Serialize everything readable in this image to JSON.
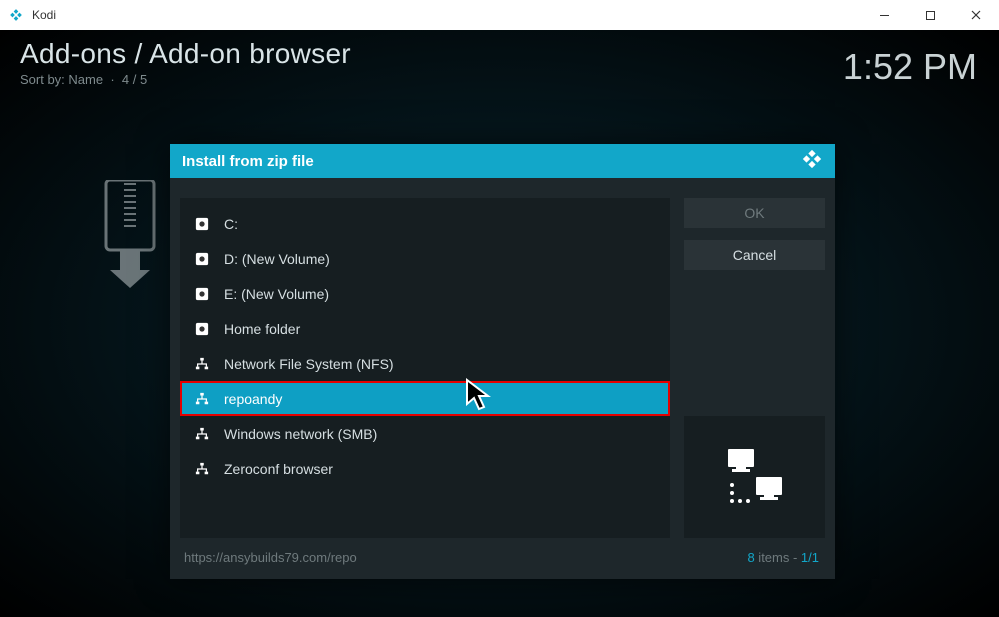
{
  "titlebar": {
    "app_name": "Kodi"
  },
  "header": {
    "breadcrumb": "Add-ons / Add-on browser",
    "sort_label": "Sort by: Name",
    "position": "4 / 5",
    "clock": "1:52 PM"
  },
  "dialog": {
    "title": "Install from zip file",
    "items": [
      {
        "label": "C:",
        "icon": "disk"
      },
      {
        "label": "D: (New Volume)",
        "icon": "disk"
      },
      {
        "label": "E: (New Volume)",
        "icon": "disk"
      },
      {
        "label": "Home folder",
        "icon": "disk"
      },
      {
        "label": "Network File System (NFS)",
        "icon": "net"
      },
      {
        "label": "repoandy",
        "icon": "net",
        "selected": true,
        "highlighted": true
      },
      {
        "label": "Windows network (SMB)",
        "icon": "net"
      },
      {
        "label": "Zeroconf browser",
        "icon": "net"
      }
    ],
    "buttons": {
      "ok": "OK",
      "cancel": "Cancel"
    },
    "footer": {
      "url": "https://ansybuilds79.com/repo",
      "count": "8",
      "count_suffix": " items - ",
      "page": "1/1"
    }
  }
}
